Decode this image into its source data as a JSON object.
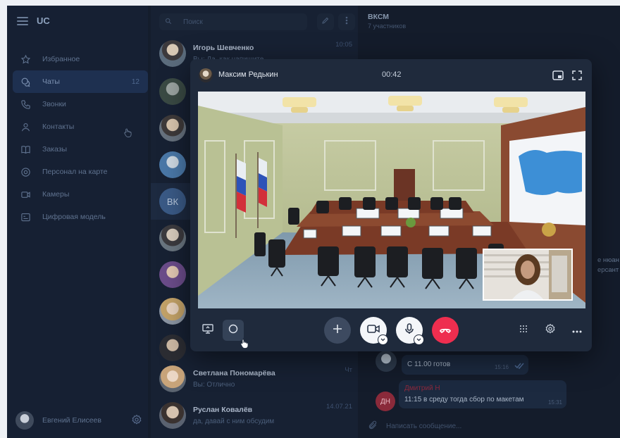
{
  "sidebar": {
    "brand": "UC",
    "items": [
      {
        "label": "Избранное",
        "icon": "star-icon"
      },
      {
        "label": "Чаты",
        "icon": "chat-icon",
        "count": "12",
        "active": true
      },
      {
        "label": "Звонки",
        "icon": "phone-icon"
      },
      {
        "label": "Контакты",
        "icon": "person-icon"
      },
      {
        "label": "Заказы",
        "icon": "book-icon"
      },
      {
        "label": "Персонал на карте",
        "icon": "map-pin-icon"
      },
      {
        "label": "Камеры",
        "icon": "camera-icon"
      },
      {
        "label": "Цифровая модель",
        "icon": "model-icon"
      }
    ],
    "user": "Евгений Елисеев"
  },
  "chatlist": {
    "search_placeholder": "Поиск",
    "rows": [
      {
        "name": "Игорь Шевченко",
        "preview": "Вы: Да, как напишите",
        "time": "10:05"
      },
      {
        "name": "",
        "preview": "",
        "time": ""
      },
      {
        "name": "",
        "preview": "",
        "time": ""
      },
      {
        "name": "",
        "preview": "",
        "time": ""
      },
      {
        "name": "",
        "preview": "",
        "time": "",
        "initials": "ВК"
      },
      {
        "name": "",
        "preview": "",
        "time": ""
      },
      {
        "name": "",
        "preview": "",
        "time": ""
      },
      {
        "name": "",
        "preview": "",
        "time": ""
      },
      {
        "name": "",
        "preview": "",
        "time": ""
      },
      {
        "name": "Светлана Пономарёва",
        "preview": "Вы: Отлично",
        "time": "Чт"
      },
      {
        "name": "Руслан Ковалёв",
        "preview": "да, давай с ним обсудим",
        "time": "14.07.21"
      }
    ]
  },
  "chat": {
    "title": "ВКСМ",
    "subtitle": "7 участников",
    "snippet1": "е нюан",
    "snippet2": "ерсант",
    "msg1_text": "С 11.00 готов",
    "msg1_time": "15:16",
    "msg2_author": "Дмитрий Н",
    "msg2_text": "11:15 в среду тогда сбор по макетам",
    "msg2_time": "15:31",
    "msg2_initials": "ДН",
    "input_placeholder": "Написать сообщение..."
  },
  "call": {
    "caller": "Максим Редькин",
    "timer": "00:42"
  },
  "colors": {
    "accent": "#1e3050",
    "hangup": "#ee2e4f",
    "bg": "#141d2c"
  }
}
